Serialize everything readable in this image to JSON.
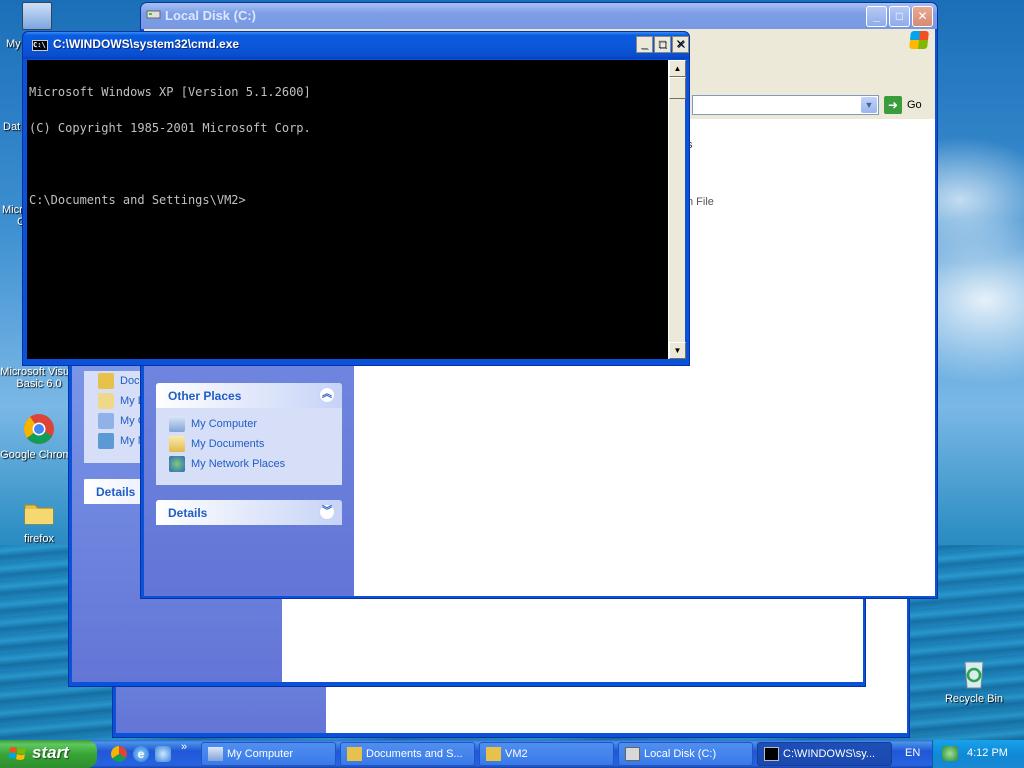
{
  "desktop": {
    "icons": [
      {
        "label": "Microsoft Visual Basic 6.0",
        "icon": "visual-basic-icon"
      },
      {
        "label": "Google Chrome",
        "icon": "chrome-icon"
      },
      {
        "label": "firefox",
        "icon": "folder-icon"
      },
      {
        "label": "Recycle Bin",
        "icon": "recycle-bin-icon"
      }
    ],
    "partial_labels": [
      "My",
      "Dat",
      "Micro",
      "C"
    ]
  },
  "explorer_back": {
    "partial_links": [
      "Docu",
      "My D",
      "My C",
      "My N"
    ],
    "details_label": "Details"
  },
  "explorer_front": {
    "title": "Local Disk (C:)",
    "go_label": "Go",
    "partial_text_1": "s",
    "partial_text_2": "h File",
    "other_places": {
      "title": "Other Places",
      "items": [
        {
          "label": "My Computer",
          "icon": "my-computer-icon"
        },
        {
          "label": "My Documents",
          "icon": "my-documents-icon"
        },
        {
          "label": "My Network Places",
          "icon": "network-places-icon"
        }
      ]
    },
    "details": {
      "title": "Details"
    }
  },
  "cmd": {
    "title": "C:\\WINDOWS\\system32\\cmd.exe",
    "lines": [
      "Microsoft Windows XP [Version 5.1.2600]",
      "(C) Copyright 1985-2001 Microsoft Corp.",
      "",
      "C:\\Documents and Settings\\VM2>"
    ]
  },
  "taskbar": {
    "start_label": "start",
    "quick_launch": [
      "chrome-icon",
      "internet-explorer-icon",
      "outlook-icon"
    ],
    "chevron": "»",
    "tasks": [
      {
        "label": "My Computer",
        "icon": "my-computer-icon",
        "active": false
      },
      {
        "label": "Documents and S...",
        "icon": "folder-icon",
        "active": false
      },
      {
        "label": "VM2",
        "icon": "folder-icon",
        "active": false
      },
      {
        "label": "Local Disk (C:)",
        "icon": "drive-icon",
        "active": false
      },
      {
        "label": "C:\\WINDOWS\\sy...",
        "icon": "cmd-icon",
        "active": true
      }
    ],
    "language": "EN",
    "clock": "4:12 PM"
  }
}
